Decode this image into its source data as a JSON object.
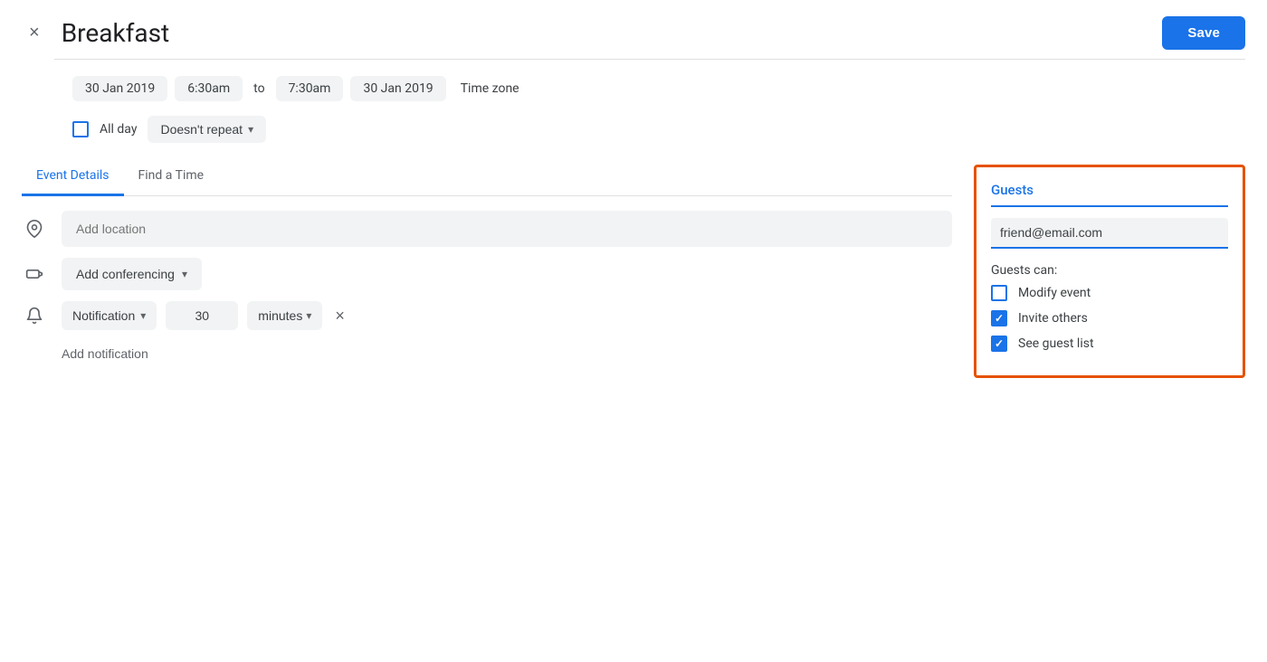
{
  "header": {
    "close_icon": "×",
    "title": "Breakfast",
    "save_label": "Save"
  },
  "datetime": {
    "start_date": "30 Jan 2019",
    "start_time": "6:30am",
    "to": "to",
    "end_time": "7:30am",
    "end_date": "30 Jan 2019",
    "timezone": "Time zone"
  },
  "allday": {
    "label": "All day",
    "repeat_label": "Doesn't repeat"
  },
  "tabs": [
    {
      "label": "Event Details",
      "active": true
    },
    {
      "label": "Find a Time",
      "active": false
    }
  ],
  "location": {
    "placeholder": "Add location"
  },
  "conferencing": {
    "label": "Add conferencing"
  },
  "notification": {
    "type": "Notification",
    "value": "30",
    "unit": "minutes"
  },
  "add_notification": {
    "label": "Add notification"
  },
  "guests": {
    "title": "Guests",
    "input_value": "friend@email.com",
    "can_label": "Guests can:",
    "permissions": [
      {
        "label": "Modify event",
        "checked": false
      },
      {
        "label": "Invite others",
        "checked": true
      },
      {
        "label": "See guest list",
        "checked": true
      }
    ]
  }
}
